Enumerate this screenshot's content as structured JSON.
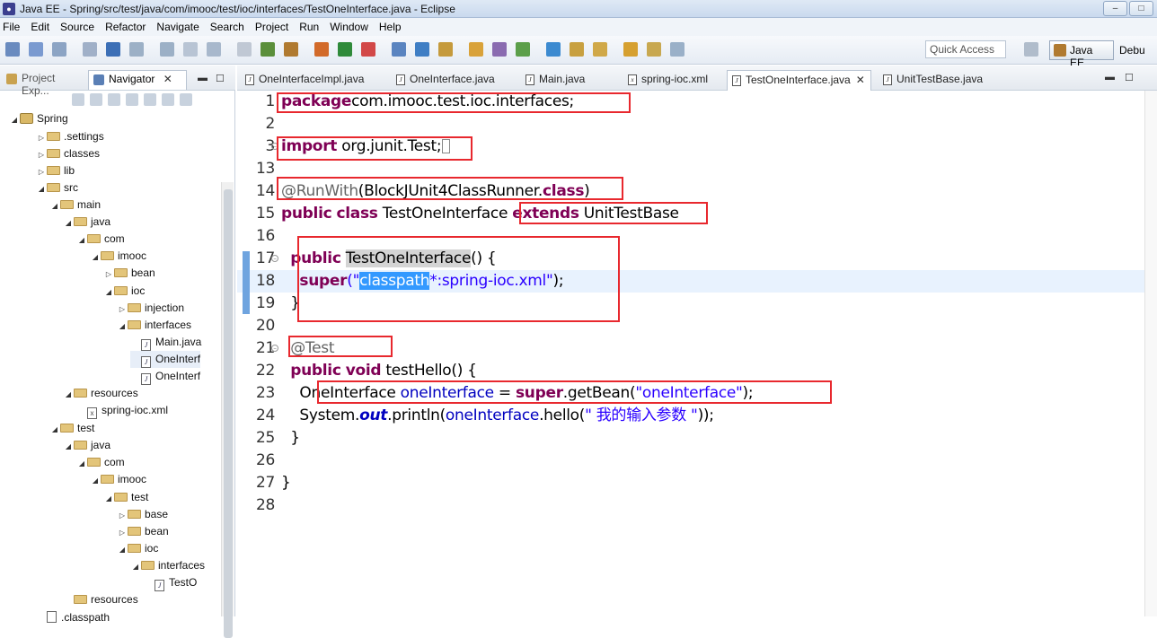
{
  "window": {
    "title": "Java EE - Spring/src/test/java/com/imooc/test/ioc/interfaces/TestOneInterface.java - Eclipse",
    "icon": "eclipse-icon"
  },
  "menu": [
    "File",
    "Edit",
    "Source",
    "Refactor",
    "Navigate",
    "Search",
    "Project",
    "Run",
    "Window",
    "Help"
  ],
  "toolbar": {
    "quick_access": "Quick Access",
    "perspective": "Java EE",
    "debug_perspective": "Debu"
  },
  "left_panel": {
    "tabs": [
      {
        "label": "Project Exp...",
        "icon": "project-explorer-icon"
      },
      {
        "label": "Navigator",
        "icon": "navigator-icon"
      }
    ],
    "tree": [
      {
        "label": "Spring",
        "kind": "project",
        "twisty": "expanded"
      },
      {
        "label": ".settings",
        "kind": "folder",
        "twisty": "collapsed"
      },
      {
        "label": "classes",
        "kind": "folder",
        "twisty": "collapsed"
      },
      {
        "label": "lib",
        "kind": "folder",
        "twisty": "collapsed"
      },
      {
        "label": "src",
        "kind": "folder",
        "twisty": "expanded"
      },
      {
        "label": "main",
        "kind": "folder",
        "twisty": "expanded"
      },
      {
        "label": "java",
        "kind": "folder",
        "twisty": "expanded"
      },
      {
        "label": "com",
        "kind": "folder",
        "twisty": "expanded"
      },
      {
        "label": "imooc",
        "kind": "folder",
        "twisty": "expanded"
      },
      {
        "label": "bean",
        "kind": "folder",
        "twisty": "collapsed"
      },
      {
        "label": "ioc",
        "kind": "folder",
        "twisty": "expanded"
      },
      {
        "label": "injection",
        "kind": "folder",
        "twisty": "collapsed"
      },
      {
        "label": "interfaces",
        "kind": "folder",
        "twisty": "expanded"
      },
      {
        "label": "Main.java",
        "kind": "java",
        "twisty": "none"
      },
      {
        "label": "OneInterf",
        "kind": "java",
        "twisty": "none"
      },
      {
        "label": "OneInterf",
        "kind": "java",
        "twisty": "none"
      },
      {
        "label": "resources",
        "kind": "folder",
        "twisty": "expanded"
      },
      {
        "label": "spring-ioc.xml",
        "kind": "xml",
        "twisty": "none"
      },
      {
        "label": "test",
        "kind": "folder",
        "twisty": "expanded"
      },
      {
        "label": "java",
        "kind": "folder",
        "twisty": "expanded"
      },
      {
        "label": "com",
        "kind": "folder",
        "twisty": "expanded"
      },
      {
        "label": "imooc",
        "kind": "folder",
        "twisty": "expanded"
      },
      {
        "label": "test",
        "kind": "folder",
        "twisty": "expanded"
      },
      {
        "label": "base",
        "kind": "folder",
        "twisty": "collapsed"
      },
      {
        "label": "bean",
        "kind": "folder",
        "twisty": "collapsed"
      },
      {
        "label": "ioc",
        "kind": "folder",
        "twisty": "expanded"
      },
      {
        "label": "interfaces",
        "kind": "folder",
        "twisty": "expanded"
      },
      {
        "label": "TestO",
        "kind": "java",
        "twisty": "none"
      },
      {
        "label": "resources",
        "kind": "folder",
        "twisty": "none"
      },
      {
        "label": ".classpath",
        "kind": "file",
        "twisty": "none"
      }
    ]
  },
  "editor": {
    "tabs": [
      {
        "label": "OneInterfaceImpl.java",
        "icon": "java-file-icon",
        "active": false
      },
      {
        "label": "OneInterface.java",
        "icon": "java-file-icon",
        "active": false
      },
      {
        "label": "Main.java",
        "icon": "java-file-icon",
        "active": false
      },
      {
        "label": "spring-ioc.xml",
        "icon": "xml-file-icon",
        "active": false
      },
      {
        "label": "TestOneInterface.java",
        "icon": "java-file-icon",
        "active": true
      },
      {
        "label": "UnitTestBase.java",
        "icon": "java-file-icon",
        "active": false
      }
    ],
    "lines": [
      {
        "n": "1",
        "parts": [
          [
            "kw",
            "package"
          ],
          [
            "",
            "com.imooc.test.ioc.interfaces;"
          ]
        ]
      },
      {
        "n": "2",
        "parts": []
      },
      {
        "n": "3",
        "fold": true,
        "parts": [
          [
            "kw",
            "import"
          ],
          [
            "",
            " org.junit.Test;"
          ]
        ]
      },
      {
        "n": "13",
        "parts": []
      },
      {
        "n": "14",
        "parts": [
          [
            "ann",
            "@RunWith"
          ],
          [
            "",
            "(BlockJUnit4ClassRunner."
          ],
          [
            "kw",
            "class"
          ],
          [
            "",
            ")"
          ]
        ]
      },
      {
        "n": "15",
        "parts": [
          [
            "kw",
            "public"
          ],
          [
            "",
            " "
          ],
          [
            "kw",
            "class"
          ],
          [
            "",
            " TestOneInterface "
          ],
          [
            "kw",
            "extends"
          ],
          [
            "",
            " UnitTestBase"
          ]
        ]
      },
      {
        "n": "16",
        "parts": []
      },
      {
        "n": "17",
        "fold": true,
        "parts": [
          [
            "",
            "  "
          ],
          [
            "kw",
            "public"
          ],
          [
            "",
            " "
          ],
          [
            "hl",
            "TestOneInterface"
          ],
          [
            "",
            "() {"
          ]
        ]
      },
      {
        "n": "18",
        "current": true,
        "parts": [
          [
            "",
            "    "
          ],
          [
            "kw",
            "super"
          ],
          [
            "str",
            "(\""
          ],
          [
            "selb",
            "classpath"
          ],
          [
            "str",
            "*:spring-ioc.xml\""
          ],
          [
            "",
            ");"
          ]
        ]
      },
      {
        "n": "19",
        "parts": [
          [
            "",
            "  }"
          ]
        ]
      },
      {
        "n": "20",
        "parts": []
      },
      {
        "n": "21",
        "fold": true,
        "parts": [
          [
            "",
            "  "
          ],
          [
            "ann",
            "@Test"
          ]
        ]
      },
      {
        "n": "22",
        "parts": [
          [
            "",
            "  "
          ],
          [
            "kw",
            "public"
          ],
          [
            "",
            " "
          ],
          [
            "kw",
            "void"
          ],
          [
            "",
            " testHello() {"
          ]
        ]
      },
      {
        "n": "23",
        "parts": [
          [
            "",
            "    OneInterface "
          ],
          [
            "fld2",
            "oneInterface"
          ],
          [
            "",
            " = "
          ],
          [
            "kw",
            "super"
          ],
          [
            "",
            ".getBean("
          ],
          [
            "str",
            "\"oneInterface\""
          ],
          [
            "",
            ");"
          ]
        ]
      },
      {
        "n": "24",
        "parts": [
          [
            "",
            "    System."
          ],
          [
            "stat",
            "out"
          ],
          [
            "",
            ".println("
          ],
          [
            "fld2",
            "oneInterface"
          ],
          [
            "",
            ".hello("
          ],
          [
            "str",
            "\" 我的输入参数 \""
          ],
          [
            "",
            "));"
          ]
        ]
      },
      {
        "n": "25",
        "parts": [
          [
            "",
            "  }"
          ]
        ]
      },
      {
        "n": "26",
        "parts": []
      },
      {
        "n": "27",
        "parts": [
          [
            "",
            "}"
          ]
        ]
      },
      {
        "n": "28",
        "parts": []
      }
    ]
  },
  "colors": {
    "highlight_box": "#e8282e",
    "keyword": "#7f0055",
    "string": "#2a00ff",
    "annotation": "#646464",
    "selection": "#3399ff"
  }
}
